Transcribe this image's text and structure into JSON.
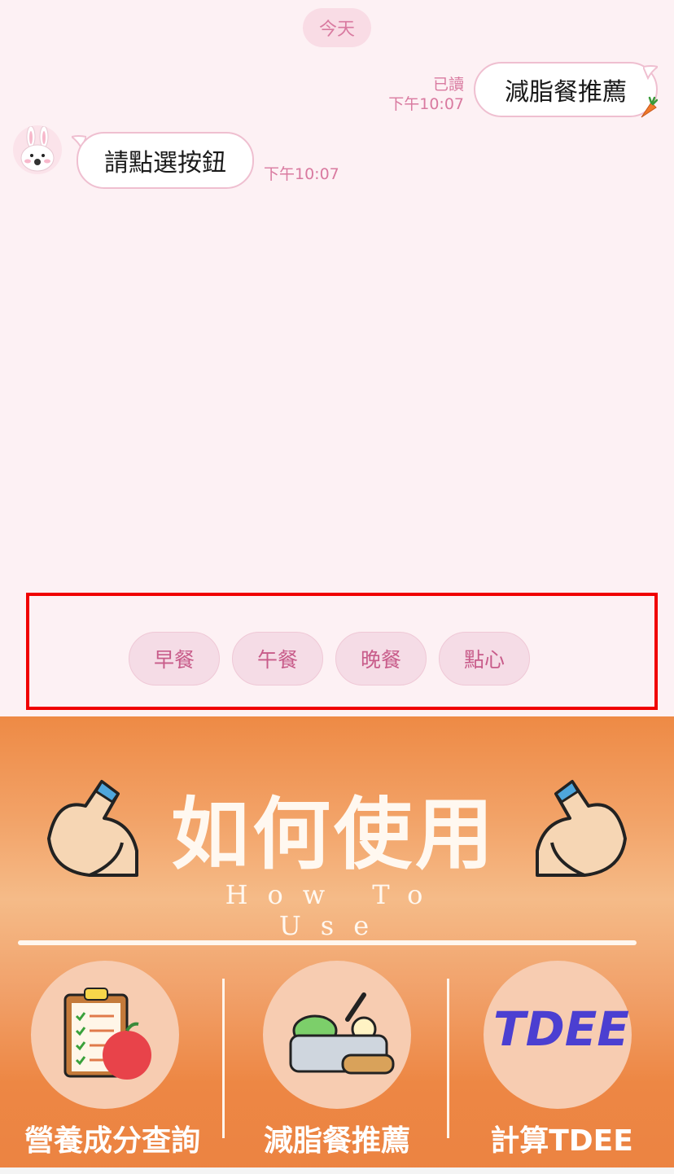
{
  "chat": {
    "date_label": "今天",
    "user_message": {
      "text": "減脂餐推薦",
      "read_label": "已讀",
      "time": "下午10:07"
    },
    "bot_message": {
      "text": "請點選按鈕",
      "time": "下午10:07"
    }
  },
  "quick_replies": [
    "早餐",
    "午餐",
    "晚餐",
    "點心"
  ],
  "rich_menu": {
    "title": "如何使用",
    "subtitle": "How To Use",
    "items": [
      {
        "label": "營養成分查詢",
        "icon": "clipboard-apple-icon"
      },
      {
        "label": "減脂餐推薦",
        "icon": "food-bowl-icon"
      },
      {
        "label": "計算TDEE",
        "icon": "tdee-text-icon",
        "icon_text": "TDEE"
      }
    ]
  },
  "colors": {
    "background": "#fdf1f4",
    "accent_pink": "#d97aa0",
    "highlight_frame": "#f00000",
    "menu_orange": "#ee8a45",
    "tdee_blue": "#4b3fd1"
  }
}
